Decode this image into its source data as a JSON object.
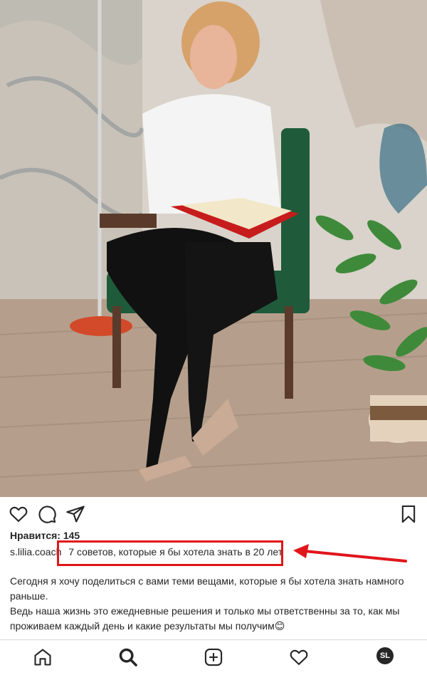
{
  "post": {
    "likes_label": "Нравится: 145",
    "username": "s.lilia.coach",
    "caption": "7 советов, которые я бы хотела знать в 20 лет",
    "body_line1": "Сегодня я хочу поделиться с вами теми вещами, которые я бы хотела знать намного раньше.",
    "body_line2": "Ведь наша жизнь это ежедневные решения и только мы ответственны за то, как мы проживаем каждый день и какие результаты мы получим",
    "emoji": "😊"
  },
  "nav": {
    "avatar_initials": "SL"
  },
  "colors": {
    "highlight": "#e0161b",
    "text": "#262626"
  },
  "icons": [
    "heart-icon",
    "comment-icon",
    "share-icon",
    "bookmark-icon",
    "home-icon",
    "search-icon",
    "add-post-icon",
    "activity-heart-icon"
  ]
}
